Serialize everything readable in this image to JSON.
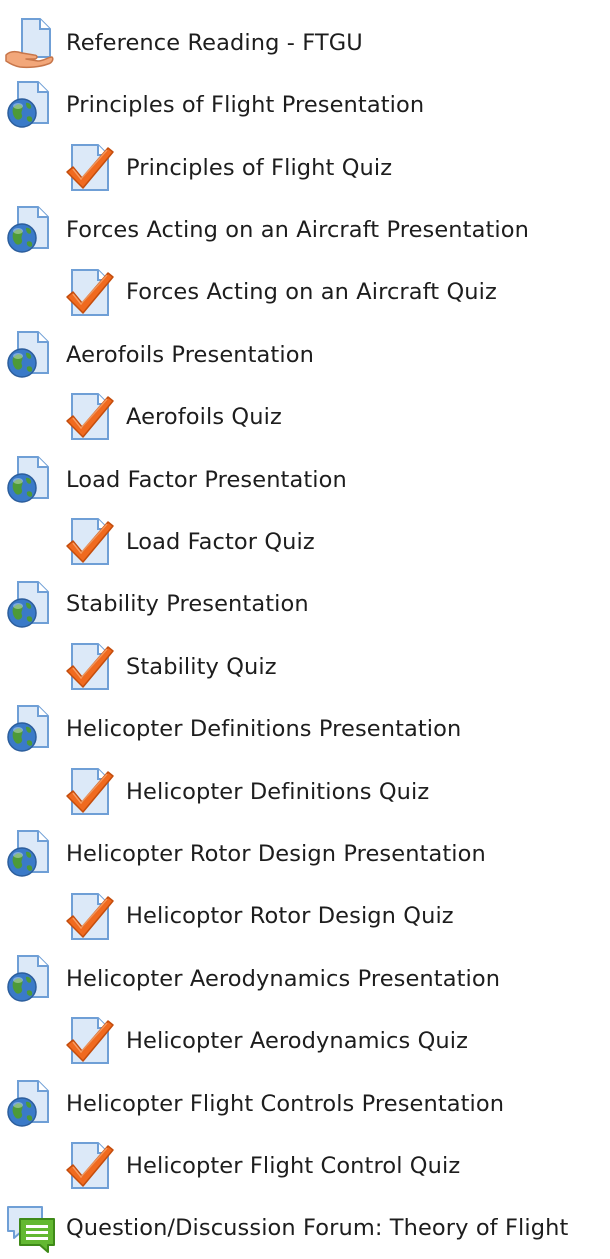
{
  "activities": [
    {
      "label": "Reference Reading - FTGU",
      "icon": "file-hand-icon",
      "level": 0
    },
    {
      "label": "Principles of Flight Presentation",
      "icon": "url-globe-icon",
      "level": 0
    },
    {
      "label": "Principles of Flight Quiz",
      "icon": "quiz-checkmark-icon",
      "level": 1
    },
    {
      "label": "Forces Acting on an Aircraft Presentation",
      "icon": "url-globe-icon",
      "level": 0
    },
    {
      "label": "Forces Acting on an Aircraft Quiz",
      "icon": "quiz-checkmark-icon",
      "level": 1
    },
    {
      "label": "Aerofoils Presentation",
      "icon": "url-globe-icon",
      "level": 0
    },
    {
      "label": "Aerofoils Quiz",
      "icon": "quiz-checkmark-icon",
      "level": 1
    },
    {
      "label": "Load Factor Presentation",
      "icon": "url-globe-icon",
      "level": 0
    },
    {
      "label": "Load Factor Quiz",
      "icon": "quiz-checkmark-icon",
      "level": 1
    },
    {
      "label": "Stability Presentation",
      "icon": "url-globe-icon",
      "level": 0
    },
    {
      "label": "Stability Quiz",
      "icon": "quiz-checkmark-icon",
      "level": 1
    },
    {
      "label": "Helicopter Definitions Presentation",
      "icon": "url-globe-icon",
      "level": 0
    },
    {
      "label": "Helicopter Definitions Quiz",
      "icon": "quiz-checkmark-icon",
      "level": 1
    },
    {
      "label": "Helicopter Rotor Design Presentation",
      "icon": "url-globe-icon",
      "level": 0
    },
    {
      "label": "Helicoptor Rotor Design Quiz",
      "icon": "quiz-checkmark-icon",
      "level": 1
    },
    {
      "label": "Helicopter Aerodynamics Presentation",
      "icon": "url-globe-icon",
      "level": 0
    },
    {
      "label": "Helicopter Aerodynamics Quiz",
      "icon": "quiz-checkmark-icon",
      "level": 1
    },
    {
      "label": "Helicopter Flight Controls Presentation",
      "icon": "url-globe-icon",
      "level": 0
    },
    {
      "label": "Helicopter Flight Control Quiz",
      "icon": "quiz-checkmark-icon",
      "level": 1
    },
    {
      "label": "Question/Discussion Forum: Theory of Flight",
      "icon": "forum-chat-icon",
      "level": 0
    }
  ],
  "colors": {
    "page_fill": "#dce9f8",
    "page_stroke": "#6f9fd6",
    "globe_blue": "#3a7ac8",
    "globe_green": "#4d9a38",
    "check_orange": "#f06a1f",
    "forum_green": "#63b832",
    "hand_skin": "#f2a77a"
  }
}
